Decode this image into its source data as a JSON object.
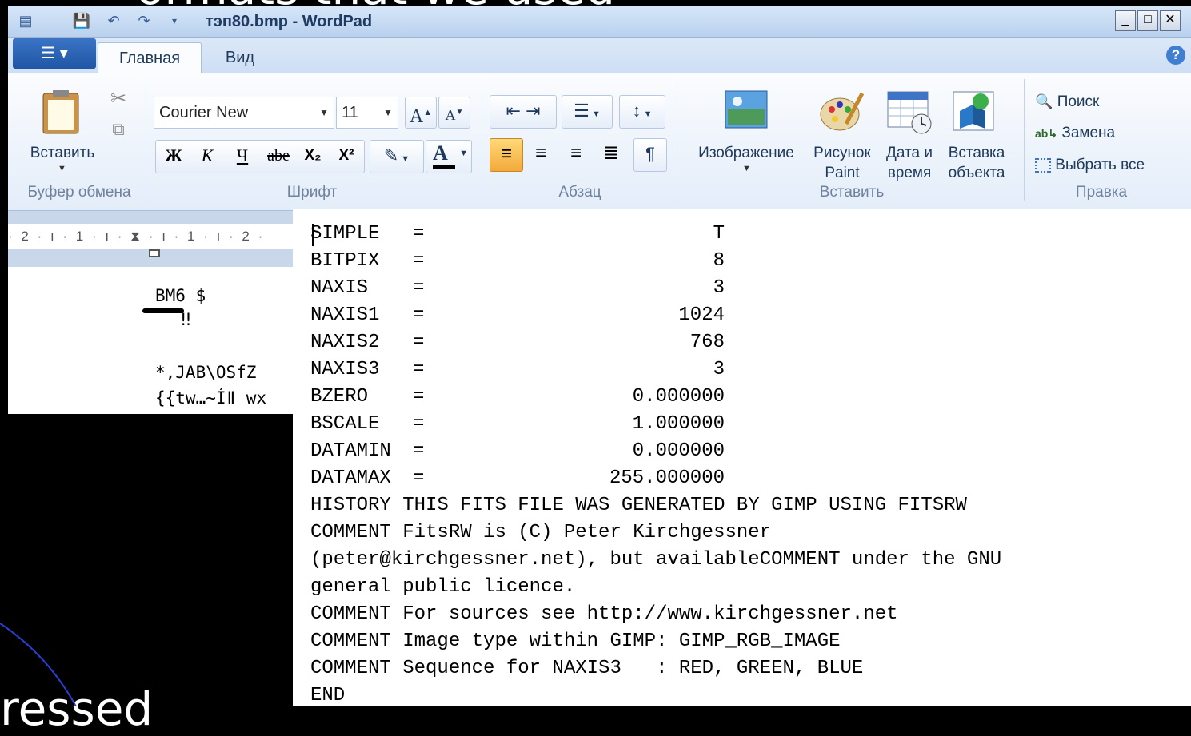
{
  "slide": {
    "top_text": "ormats that we used",
    "bottom_text": "ressed"
  },
  "window": {
    "title": "тэп80.bmp - WordPad",
    "tabs": {
      "home": "Главная",
      "view": "Вид"
    },
    "font_name": "Courier New",
    "font_size": "11",
    "buttons": {
      "paste": "Вставить",
      "image": "Изображение",
      "paint_line1": "Рисунок",
      "paint_line2": "Paint",
      "datetime_line1": "Дата и",
      "datetime_line2": "время",
      "object_line1": "Вставка",
      "object_line2": "объекта",
      "find": "Поиск",
      "replace": "Замена",
      "select_all": "Выбрать все"
    },
    "format_buttons": {
      "bold": "Ж",
      "italic": "К",
      "underline": "Ч",
      "strike": "abe",
      "sub": "X₂",
      "sup": "X²",
      "grow": "A",
      "shrink": "A",
      "color": "A"
    },
    "groups": {
      "clipboard": "Буфер обмена",
      "font": "Шрифт",
      "paragraph": "Абзац",
      "insert": "Вставить",
      "editing": "Правка"
    },
    "ruler_text": "· 2 · ı · 1 · ı · ⧗ · ı · 1 · ı · 2 ·",
    "document_lines": [
      "BM6  $",
      "‼",
      "*,JAB\\OSfZ",
      "{{tw…~Íǁ wx"
    ]
  },
  "fits_header": {
    "keyword_rows": [
      {
        "key": "SIMPLE",
        "eq": "=",
        "value": "T"
      },
      {
        "key": "BITPIX",
        "eq": "=",
        "value": "8"
      },
      {
        "key": "NAXIS",
        "eq": "=",
        "value": "3"
      },
      {
        "key": "NAXIS1",
        "eq": "=",
        "value": "1024"
      },
      {
        "key": "NAXIS2",
        "eq": "=",
        "value": "768"
      },
      {
        "key": "NAXIS3",
        "eq": "=",
        "value": "3"
      },
      {
        "key": "BZERO",
        "eq": "=",
        "value": "0.000000"
      },
      {
        "key": "BSCALE",
        "eq": "=",
        "value": "1.000000"
      },
      {
        "key": "DATAMIN",
        "eq": "=",
        "value": "0.000000"
      },
      {
        "key": "DATAMAX",
        "eq": "=",
        "value": "255.000000"
      }
    ],
    "text_lines": [
      "HISTORY THIS FITS FILE WAS GENERATED BY GIMP USING FITSRW",
      "COMMENT FitsRW is (C) Peter Kirchgessner",
      "(peter@kirchgessner.net), but availableCOMMENT under the GNU",
      "general public licence.",
      "COMMENT For sources see http://www.kirchgessner.net",
      "COMMENT Image type within GIMP: GIMP_RGB_IMAGE",
      "COMMENT Sequence for NAXIS3   : RED, GREEN, BLUE",
      "END"
    ]
  }
}
